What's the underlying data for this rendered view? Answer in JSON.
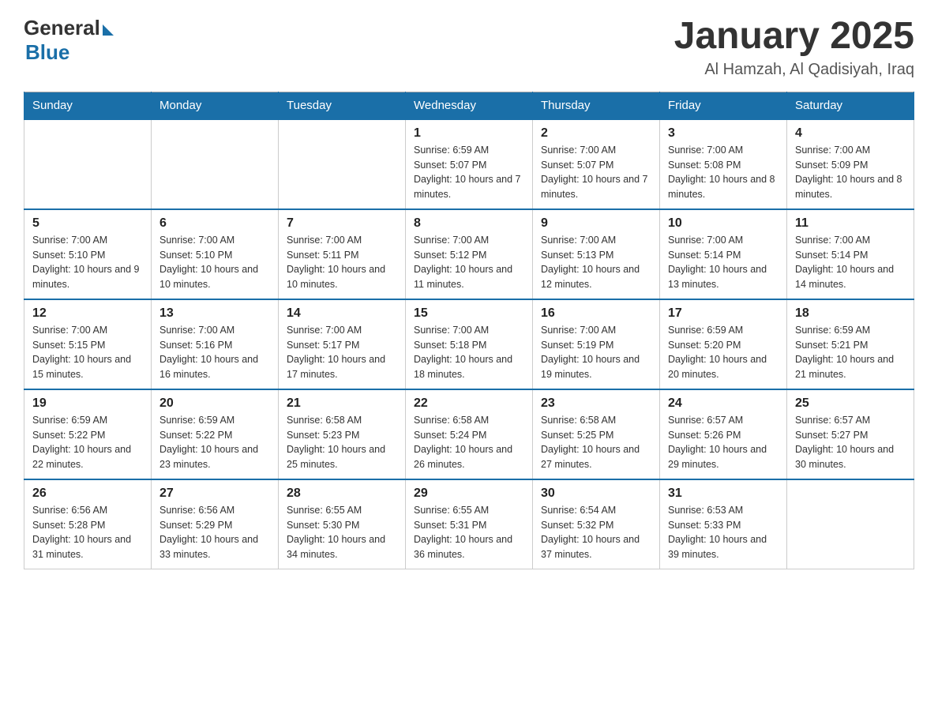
{
  "header": {
    "logo_general": "General",
    "logo_blue": "Blue",
    "month_year": "January 2025",
    "location": "Al Hamzah, Al Qadisiyah, Iraq"
  },
  "days_of_week": [
    "Sunday",
    "Monday",
    "Tuesday",
    "Wednesday",
    "Thursday",
    "Friday",
    "Saturday"
  ],
  "weeks": [
    [
      {
        "day": "",
        "info": ""
      },
      {
        "day": "",
        "info": ""
      },
      {
        "day": "",
        "info": ""
      },
      {
        "day": "1",
        "info": "Sunrise: 6:59 AM\nSunset: 5:07 PM\nDaylight: 10 hours and 7 minutes."
      },
      {
        "day": "2",
        "info": "Sunrise: 7:00 AM\nSunset: 5:07 PM\nDaylight: 10 hours and 7 minutes."
      },
      {
        "day": "3",
        "info": "Sunrise: 7:00 AM\nSunset: 5:08 PM\nDaylight: 10 hours and 8 minutes."
      },
      {
        "day": "4",
        "info": "Sunrise: 7:00 AM\nSunset: 5:09 PM\nDaylight: 10 hours and 8 minutes."
      }
    ],
    [
      {
        "day": "5",
        "info": "Sunrise: 7:00 AM\nSunset: 5:10 PM\nDaylight: 10 hours and 9 minutes."
      },
      {
        "day": "6",
        "info": "Sunrise: 7:00 AM\nSunset: 5:10 PM\nDaylight: 10 hours and 10 minutes."
      },
      {
        "day": "7",
        "info": "Sunrise: 7:00 AM\nSunset: 5:11 PM\nDaylight: 10 hours and 10 minutes."
      },
      {
        "day": "8",
        "info": "Sunrise: 7:00 AM\nSunset: 5:12 PM\nDaylight: 10 hours and 11 minutes."
      },
      {
        "day": "9",
        "info": "Sunrise: 7:00 AM\nSunset: 5:13 PM\nDaylight: 10 hours and 12 minutes."
      },
      {
        "day": "10",
        "info": "Sunrise: 7:00 AM\nSunset: 5:14 PM\nDaylight: 10 hours and 13 minutes."
      },
      {
        "day": "11",
        "info": "Sunrise: 7:00 AM\nSunset: 5:14 PM\nDaylight: 10 hours and 14 minutes."
      }
    ],
    [
      {
        "day": "12",
        "info": "Sunrise: 7:00 AM\nSunset: 5:15 PM\nDaylight: 10 hours and 15 minutes."
      },
      {
        "day": "13",
        "info": "Sunrise: 7:00 AM\nSunset: 5:16 PM\nDaylight: 10 hours and 16 minutes."
      },
      {
        "day": "14",
        "info": "Sunrise: 7:00 AM\nSunset: 5:17 PM\nDaylight: 10 hours and 17 minutes."
      },
      {
        "day": "15",
        "info": "Sunrise: 7:00 AM\nSunset: 5:18 PM\nDaylight: 10 hours and 18 minutes."
      },
      {
        "day": "16",
        "info": "Sunrise: 7:00 AM\nSunset: 5:19 PM\nDaylight: 10 hours and 19 minutes."
      },
      {
        "day": "17",
        "info": "Sunrise: 6:59 AM\nSunset: 5:20 PM\nDaylight: 10 hours and 20 minutes."
      },
      {
        "day": "18",
        "info": "Sunrise: 6:59 AM\nSunset: 5:21 PM\nDaylight: 10 hours and 21 minutes."
      }
    ],
    [
      {
        "day": "19",
        "info": "Sunrise: 6:59 AM\nSunset: 5:22 PM\nDaylight: 10 hours and 22 minutes."
      },
      {
        "day": "20",
        "info": "Sunrise: 6:59 AM\nSunset: 5:22 PM\nDaylight: 10 hours and 23 minutes."
      },
      {
        "day": "21",
        "info": "Sunrise: 6:58 AM\nSunset: 5:23 PM\nDaylight: 10 hours and 25 minutes."
      },
      {
        "day": "22",
        "info": "Sunrise: 6:58 AM\nSunset: 5:24 PM\nDaylight: 10 hours and 26 minutes."
      },
      {
        "day": "23",
        "info": "Sunrise: 6:58 AM\nSunset: 5:25 PM\nDaylight: 10 hours and 27 minutes."
      },
      {
        "day": "24",
        "info": "Sunrise: 6:57 AM\nSunset: 5:26 PM\nDaylight: 10 hours and 29 minutes."
      },
      {
        "day": "25",
        "info": "Sunrise: 6:57 AM\nSunset: 5:27 PM\nDaylight: 10 hours and 30 minutes."
      }
    ],
    [
      {
        "day": "26",
        "info": "Sunrise: 6:56 AM\nSunset: 5:28 PM\nDaylight: 10 hours and 31 minutes."
      },
      {
        "day": "27",
        "info": "Sunrise: 6:56 AM\nSunset: 5:29 PM\nDaylight: 10 hours and 33 minutes."
      },
      {
        "day": "28",
        "info": "Sunrise: 6:55 AM\nSunset: 5:30 PM\nDaylight: 10 hours and 34 minutes."
      },
      {
        "day": "29",
        "info": "Sunrise: 6:55 AM\nSunset: 5:31 PM\nDaylight: 10 hours and 36 minutes."
      },
      {
        "day": "30",
        "info": "Sunrise: 6:54 AM\nSunset: 5:32 PM\nDaylight: 10 hours and 37 minutes."
      },
      {
        "day": "31",
        "info": "Sunrise: 6:53 AM\nSunset: 5:33 PM\nDaylight: 10 hours and 39 minutes."
      },
      {
        "day": "",
        "info": ""
      }
    ]
  ]
}
